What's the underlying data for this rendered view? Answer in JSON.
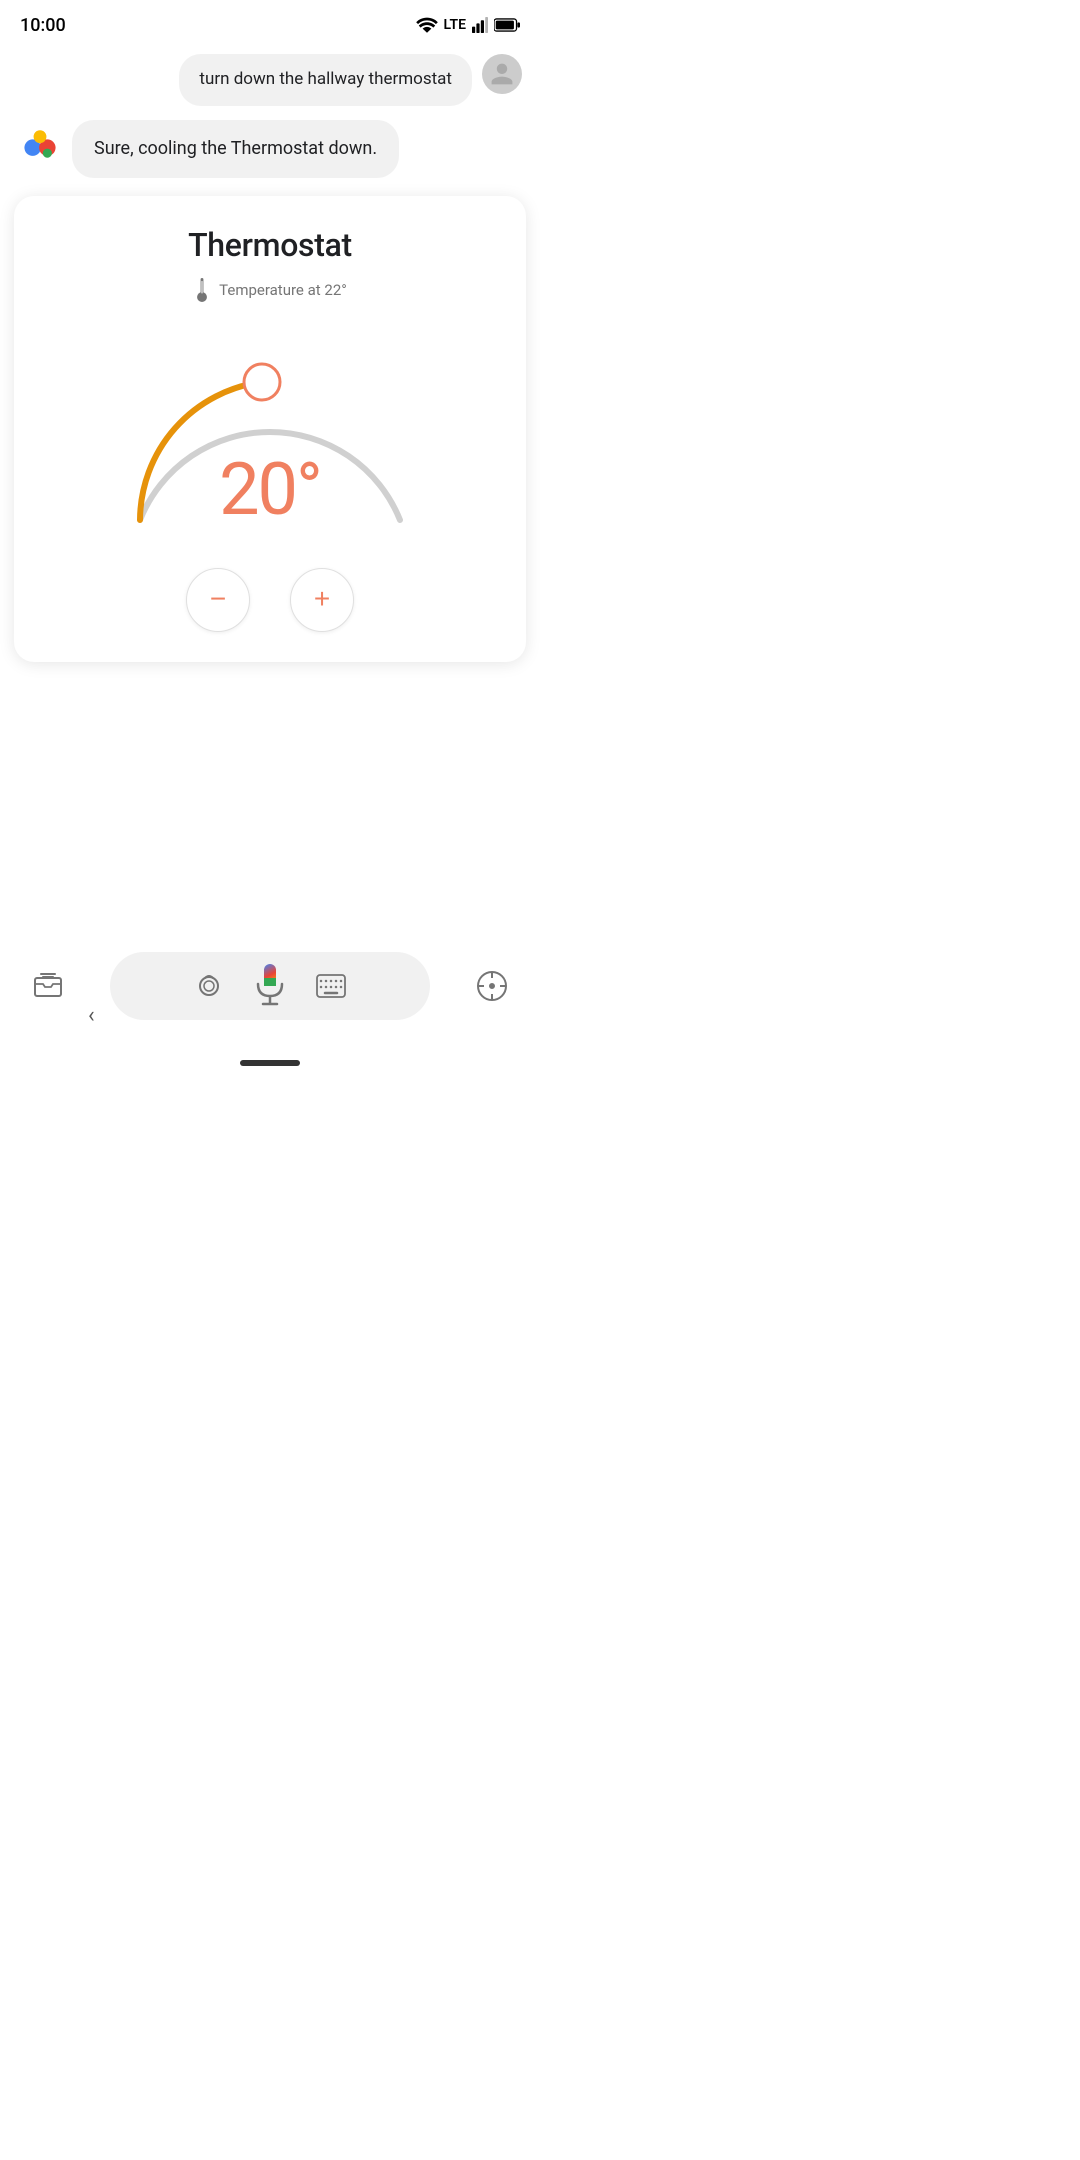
{
  "statusBar": {
    "time": "10:00"
  },
  "userMessage": {
    "text": "turn down the hallway thermostat"
  },
  "assistantMessage": {
    "text": "Sure, cooling the Thermostat down."
  },
  "thermostatCard": {
    "title": "Thermostat",
    "tempLabel": "Temperature at 22°",
    "currentTemp": "20°",
    "progressPercent": 40,
    "accentColor": "#f08060",
    "trackColor": "#cccccc",
    "activeTrackColor": "#e6920a"
  },
  "controls": {
    "decreaseLabel": "−",
    "increaseLabel": "+"
  }
}
